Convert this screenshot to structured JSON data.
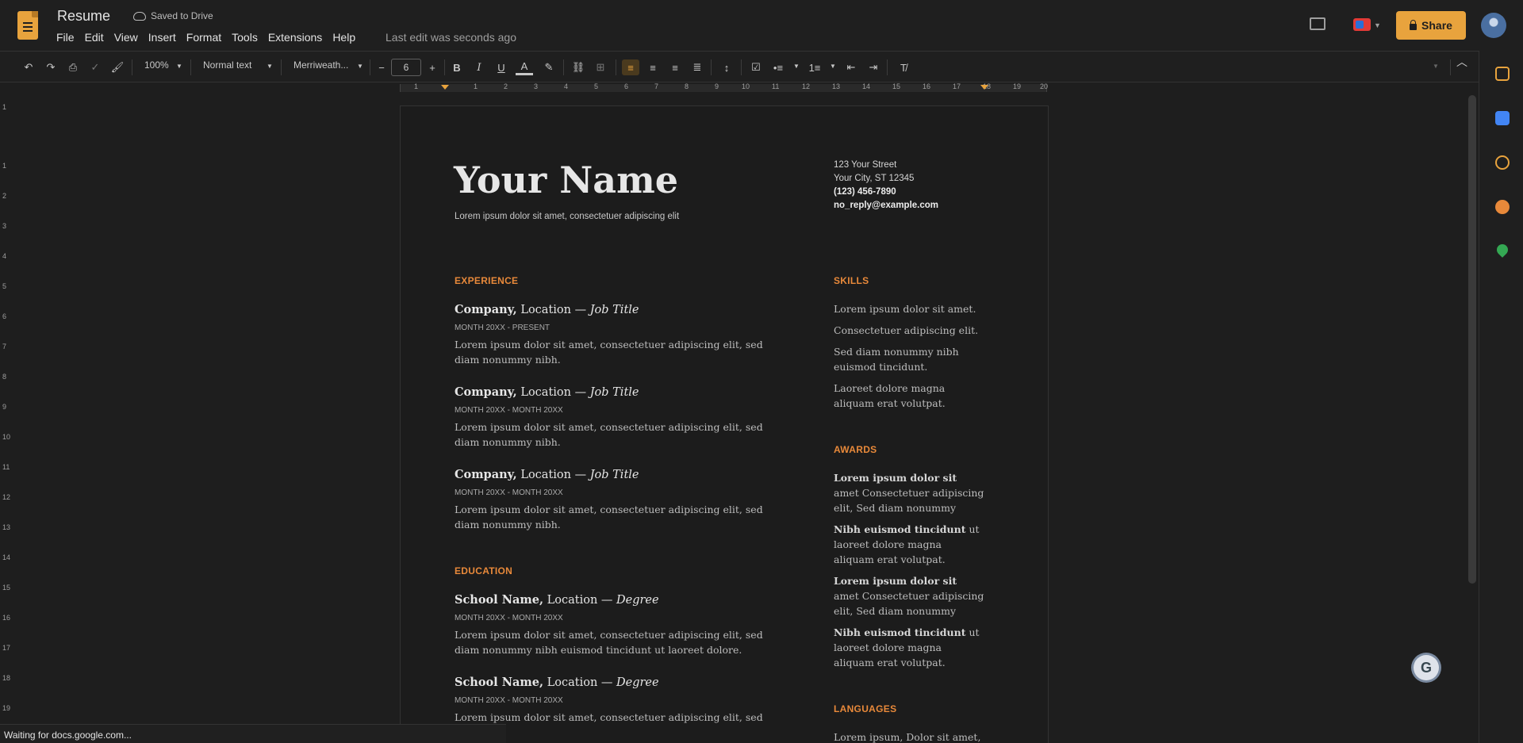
{
  "header": {
    "doc_title": "Resume",
    "saved_status": "Saved to Drive",
    "menu": [
      "File",
      "Edit",
      "View",
      "Insert",
      "Format",
      "Tools",
      "Extensions",
      "Help"
    ],
    "last_edit": "Last edit was seconds ago",
    "share_label": "Share"
  },
  "toolbar": {
    "zoom": "100%",
    "style": "Normal text",
    "font": "Merriweath...",
    "font_size": "6",
    "minus": "−",
    "plus": "+",
    "bold": "B",
    "italic": "I",
    "underline": "U",
    "text_color": "A"
  },
  "ruler": {
    "h_numbers": [
      "1",
      "1",
      "2",
      "3",
      "4",
      "5",
      "6",
      "7",
      "8",
      "9",
      "10",
      "11",
      "12",
      "13",
      "14",
      "15",
      "16",
      "17",
      "18",
      "19",
      "20"
    ],
    "v_numbers": [
      "1",
      "1",
      "2",
      "3",
      "4",
      "5",
      "6",
      "7",
      "8",
      "9",
      "10",
      "11",
      "12",
      "13",
      "14",
      "15",
      "16",
      "17",
      "18",
      "19"
    ]
  },
  "resume": {
    "name": "Your Name",
    "tagline": "Lorem ipsum dolor sit amet, consectetuer adipiscing elit",
    "contact": {
      "street": "123 Your Street",
      "city": "Your City, ST 12345",
      "phone": "(123) 456-7890",
      "email": "no_reply@example.com"
    },
    "experience_heading": "EXPERIENCE",
    "experience": [
      {
        "company": "Company,",
        "location": " Location — ",
        "title": "Job Title",
        "date": "MONTH 20XX - PRESENT",
        "desc": "Lorem ipsum dolor sit amet, consectetuer adipiscing elit, sed diam nonummy nibh."
      },
      {
        "company": "Company,",
        "location": " Location — ",
        "title": "Job Title",
        "date": "MONTH 20XX - MONTH 20XX",
        "desc": "Lorem ipsum dolor sit amet, consectetuer adipiscing elit, sed diam nonummy nibh."
      },
      {
        "company": "Company,",
        "location": " Location — ",
        "title": "Job Title",
        "date": "MONTH 20XX - MONTH 20XX",
        "desc": "Lorem ipsum dolor sit amet, consectetuer adipiscing elit, sed diam nonummy nibh."
      }
    ],
    "education_heading": "EDUCATION",
    "education": [
      {
        "school": "School Name,",
        "location": " Location — ",
        "degree": "Degree",
        "date": "MONTH 20XX - MONTH 20XX",
        "desc": "Lorem ipsum dolor sit amet, consectetuer adipiscing elit, sed diam nonummy nibh euismod tincidunt ut laoreet dolore."
      },
      {
        "school": "School Name,",
        "location": " Location — ",
        "degree": "Degree",
        "date": "MONTH 20XX - MONTH 20XX",
        "desc": "Lorem ipsum dolor sit amet, consectetuer adipiscing elit, sed diam."
      }
    ],
    "skills_heading": "SKILLS",
    "skills": [
      "Lorem ipsum dolor sit amet.",
      "Consectetuer adipiscing elit.",
      "Sed diam nonummy nibh euismod tincidunt.",
      "Laoreet dolore magna aliquam erat volutpat."
    ],
    "awards_heading": "AWARDS",
    "awards": [
      {
        "bold": "Lorem ipsum dolor sit",
        "rest": " amet Consectetuer adipiscing elit, Sed diam nonummy"
      },
      {
        "bold": "Nibh euismod tincidunt",
        "rest": " ut laoreet dolore magna aliquam erat volutpat."
      },
      {
        "bold": "Lorem ipsum dolor sit",
        "rest": " amet Consectetuer adipiscing elit, Sed diam nonummy"
      },
      {
        "bold": "Nibh euismod tincidunt",
        "rest": " ut laoreet dolore magna aliquam erat volutpat."
      }
    ],
    "languages_heading": "LANGUAGES",
    "languages_text": "Lorem ipsum, Dolor sit amet,"
  },
  "status_text": "Waiting for docs.google.com...",
  "grammarly_glyph": "G",
  "colors": {
    "accent": "#e8a33d",
    "heading": "#e8893a",
    "background": "#1e1e1e"
  }
}
